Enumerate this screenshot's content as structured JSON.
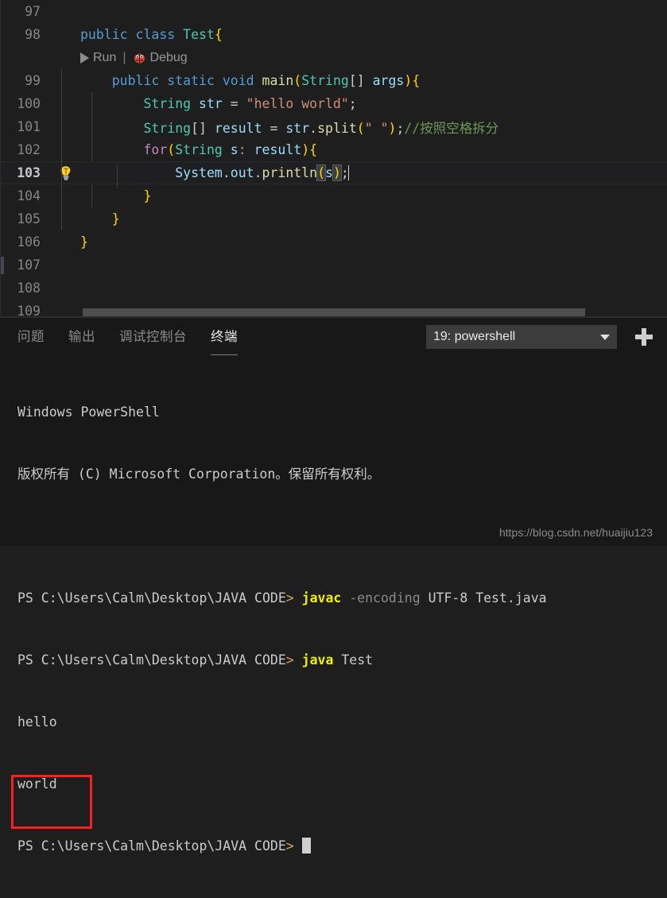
{
  "editor": {
    "language": "java",
    "colors": {
      "background": "#1e1e1e",
      "line_number": "#858585",
      "keyword": "#569cd6",
      "type": "#4ec9b0",
      "function": "#dcdcaa",
      "variable": "#9cdcfe",
      "string": "#ce9178",
      "comment": "#6a9955",
      "control": "#c586c0"
    },
    "codelens": {
      "run_label": "Run",
      "separator": "|",
      "debug_label": "Debug",
      "play_icon": "play-icon",
      "bug_icon": "bug-icon"
    },
    "active_line": 103,
    "lines": [
      {
        "number": "97",
        "tokens": []
      },
      {
        "number": "98",
        "tokens": [
          {
            "t": "public ",
            "c": "kw"
          },
          {
            "t": "class ",
            "c": "kw"
          },
          {
            "t": "Test",
            "c": "type"
          },
          {
            "t": "{",
            "c": "b1"
          }
        ]
      },
      {
        "number": "99",
        "tokens": [
          {
            "t": "    ",
            "c": "pl"
          },
          {
            "t": "public ",
            "c": "kw"
          },
          {
            "t": "static ",
            "c": "kw"
          },
          {
            "t": "void ",
            "c": "kw"
          },
          {
            "t": "main",
            "c": "fn"
          },
          {
            "t": "(",
            "c": "b1"
          },
          {
            "t": "String",
            "c": "type"
          },
          {
            "t": "[] ",
            "c": "pl"
          },
          {
            "t": "args",
            "c": "var"
          },
          {
            "t": ")",
            "c": "b1"
          },
          {
            "t": "{",
            "c": "b1"
          }
        ]
      },
      {
        "number": "100",
        "tokens": [
          {
            "t": "        ",
            "c": "pl"
          },
          {
            "t": "String",
            "c": "type"
          },
          {
            "t": " ",
            "c": "pl"
          },
          {
            "t": "str",
            "c": "var"
          },
          {
            "t": " = ",
            "c": "pl"
          },
          {
            "t": "\"hello world\"",
            "c": "str"
          },
          {
            "t": ";",
            "c": "pl"
          }
        ]
      },
      {
        "number": "101",
        "tokens": [
          {
            "t": "        ",
            "c": "pl"
          },
          {
            "t": "String",
            "c": "type"
          },
          {
            "t": "[] ",
            "c": "pl"
          },
          {
            "t": "result",
            "c": "var"
          },
          {
            "t": " = ",
            "c": "pl"
          },
          {
            "t": "str",
            "c": "var"
          },
          {
            "t": ".",
            "c": "pl"
          },
          {
            "t": "split",
            "c": "fn"
          },
          {
            "t": "(",
            "c": "b1"
          },
          {
            "t": "\" \"",
            "c": "str"
          },
          {
            "t": ")",
            "c": "b1"
          },
          {
            "t": ";",
            "c": "pl"
          },
          {
            "t": "//按照空格拆分",
            "c": "cmt"
          }
        ]
      },
      {
        "number": "102",
        "tokens": [
          {
            "t": "        ",
            "c": "pl"
          },
          {
            "t": "for",
            "c": "ctl"
          },
          {
            "t": "(",
            "c": "b1"
          },
          {
            "t": "String",
            "c": "type"
          },
          {
            "t": " ",
            "c": "pl"
          },
          {
            "t": "s",
            "c": "var"
          },
          {
            "t": ":",
            "c": "ctl"
          },
          {
            "t": " ",
            "c": "pl"
          },
          {
            "t": "result",
            "c": "var"
          },
          {
            "t": ")",
            "c": "b1"
          },
          {
            "t": "{",
            "c": "b1"
          }
        ]
      },
      {
        "number": "103",
        "tokens": [
          {
            "t": "            ",
            "c": "pl"
          },
          {
            "t": "System",
            "c": "var"
          },
          {
            "t": ".",
            "c": "pl"
          },
          {
            "t": "out",
            "c": "var"
          },
          {
            "t": ".",
            "c": "pl"
          },
          {
            "t": "println",
            "c": "fn"
          },
          {
            "t": "(",
            "c": "b1 selpar"
          },
          {
            "t": "s",
            "c": "var"
          },
          {
            "t": ")",
            "c": "b1 selpar"
          },
          {
            "t": ";",
            "c": "pl"
          }
        ]
      },
      {
        "number": "104",
        "tokens": [
          {
            "t": "        ",
            "c": "pl"
          },
          {
            "t": "}",
            "c": "b1"
          }
        ]
      },
      {
        "number": "105",
        "tokens": [
          {
            "t": "    ",
            "c": "pl"
          },
          {
            "t": "}",
            "c": "b1"
          }
        ]
      },
      {
        "number": "106",
        "tokens": [
          {
            "t": "}",
            "c": "b1"
          }
        ]
      },
      {
        "number": "107",
        "tokens": []
      },
      {
        "number": "108",
        "tokens": []
      },
      {
        "number": "109",
        "tokens": []
      }
    ],
    "lightbulb_icon": "lightbulb-icon"
  },
  "panel": {
    "tabs": [
      {
        "label": "问题",
        "active": false,
        "name": "tab-problems"
      },
      {
        "label": "输出",
        "active": false,
        "name": "tab-output"
      },
      {
        "label": "调试控制台",
        "active": false,
        "name": "tab-debug-console"
      },
      {
        "label": "终端",
        "active": true,
        "name": "tab-terminal"
      }
    ],
    "terminal_selector": {
      "value": "19: powershell",
      "chevron_icon": "chevron-down-icon"
    },
    "new_terminal_button": {
      "icon": "plus-icon",
      "title": "+"
    }
  },
  "terminal": {
    "lines": [
      {
        "type": "plain",
        "text": "Windows PowerShell"
      },
      {
        "type": "plain",
        "text": "版权所有 (C) Microsoft Corporation。保留所有权利。"
      },
      {
        "type": "blank",
        "text": ""
      },
      {
        "type": "prompt",
        "prompt": "PS C:\\Users\\Calm\\Desktop\\JAVA CODE",
        "arrow": "> ",
        "command": "javac",
        "args_dim": " -encoding",
        "args": " UTF-8 Test.java"
      },
      {
        "type": "prompt",
        "prompt": "PS C:\\Users\\Calm\\Desktop\\JAVA CODE",
        "arrow": "> ",
        "command": "java",
        "args_dim": "",
        "args": " Test"
      },
      {
        "type": "output",
        "text": "hello"
      },
      {
        "type": "output",
        "text": "world"
      },
      {
        "type": "cursor",
        "prompt": "PS C:\\Users\\Calm\\Desktop\\JAVA CODE",
        "arrow": "> "
      }
    ],
    "highlight": {
      "color": "#fb2020",
      "covers": "hello world output"
    }
  },
  "watermark": {
    "text": "https://blog.csdn.net/huaijiu123"
  }
}
